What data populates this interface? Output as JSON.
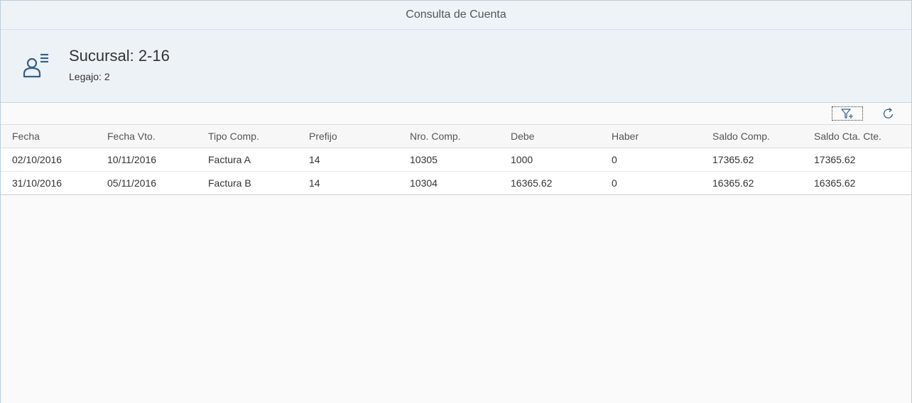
{
  "window": {
    "title": "Consulta de Cuenta"
  },
  "header": {
    "icon": "customer-list-icon",
    "title": "Sucursal: 2-16",
    "subtitle": "Legajo: 2"
  },
  "toolbar": {
    "filter_icon": "add-filter-icon",
    "refresh_icon": "refresh-icon"
  },
  "table": {
    "columns": [
      "Fecha",
      "Fecha Vto.",
      "Tipo Comp.",
      "Prefijo",
      "Nro. Comp.",
      "Debe",
      "Haber",
      "Saldo Comp.",
      "Saldo Cta. Cte."
    ],
    "rows": [
      [
        "02/10/2016",
        "10/11/2016",
        "Factura A",
        "14",
        "10305",
        "1000",
        "0",
        "17365.62",
        "17365.62"
      ],
      [
        "31/10/2016",
        "05/11/2016",
        "Factura B",
        "14",
        "10304",
        "16365.62",
        "0",
        "16365.62",
        "16365.62"
      ]
    ]
  },
  "colors": {
    "accent": "#346187",
    "header_bg": "#edf2f7",
    "border": "#b8cde0"
  }
}
